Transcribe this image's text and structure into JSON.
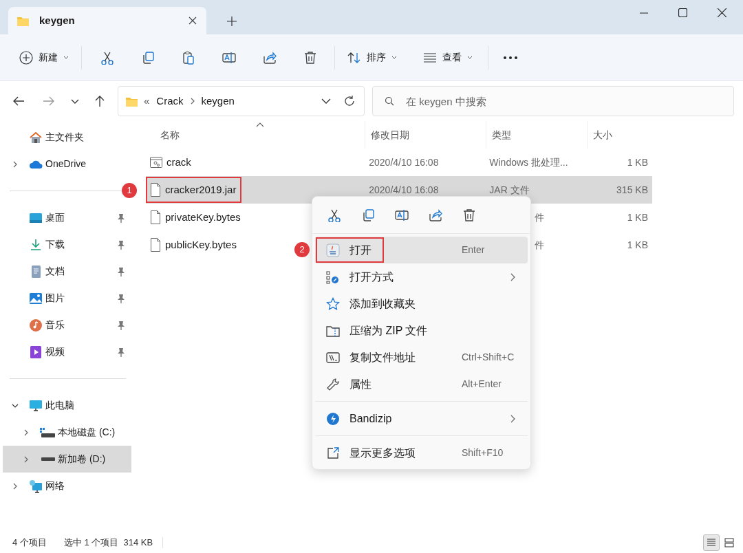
{
  "tab": {
    "title": "keygen",
    "selected": true
  },
  "toolbar": {
    "new_label": "新建",
    "sort_label": "排序",
    "view_label": "查看"
  },
  "address": {
    "overflow": "«",
    "path": [
      "Crack",
      "keygen"
    ]
  },
  "search": {
    "placeholder": "在 keygen 中搜索"
  },
  "sidebar": {
    "sections": [
      [
        {
          "label": "主文件夹",
          "pinned": false
        },
        {
          "label": "OneDrive",
          "pinned": false,
          "expanded": false
        }
      ],
      [
        {
          "label": "桌面",
          "pinned": true
        },
        {
          "label": "下载",
          "pinned": true
        },
        {
          "label": "文档",
          "pinned": true
        },
        {
          "label": "图片",
          "pinned": true
        },
        {
          "label": "音乐",
          "pinned": true
        },
        {
          "label": "视频",
          "pinned": true
        }
      ],
      [
        {
          "label": "此电脑",
          "pinned": false,
          "expanded": true,
          "children": [
            {
              "label": "本地磁盘 (C:)",
              "expanded": false,
              "selected": false
            },
            {
              "label": "新加卷 (D:)",
              "expanded": false,
              "selected": true
            }
          ]
        },
        {
          "label": "网络",
          "pinned": false,
          "expanded": false
        }
      ]
    ]
  },
  "table": {
    "columns": [
      "名称",
      "修改日期",
      "类型",
      "大小"
    ],
    "rows": [
      {
        "kind": "batch",
        "name": "crack",
        "date": "2020/4/10 16:08",
        "type": "Windows 批处理...",
        "size": "1 KB",
        "selected": false
      },
      {
        "kind": "file",
        "name": "cracker2019.jar",
        "date": "2020/4/10 16:08",
        "type": "JAR 文件",
        "size": "315 KB",
        "selected": true,
        "badge": "1"
      },
      {
        "kind": "file",
        "name": "privateKey.bytes",
        "type_tail": "件",
        "size": "1 KB",
        "selected": false
      },
      {
        "kind": "file",
        "name": "publicKey.bytes",
        "type_tail": "件",
        "size": "1 KB",
        "selected": false
      }
    ]
  },
  "context_menu": {
    "groups": [
      [
        {
          "kind": "java",
          "label": "打开",
          "shortcut": "Enter",
          "hovered": true,
          "badge": "2"
        },
        {
          "kind": "openwith",
          "label": "打开方式",
          "submenu": true,
          "hovered": false
        },
        {
          "kind": "star",
          "label": "添加到收藏夹",
          "hovered": false
        },
        {
          "kind": "zip",
          "label": "压缩为 ZIP 文件",
          "hovered": false
        },
        {
          "kind": "path",
          "label": "复制文件地址",
          "shortcut": "Ctrl+Shift+C",
          "hovered": false
        },
        {
          "kind": "wrench",
          "label": "属性",
          "shortcut": "Alt+Enter",
          "hovered": false
        }
      ],
      [
        {
          "kind": "bandizip",
          "label": "Bandizip",
          "submenu": true,
          "hovered": false
        }
      ],
      [
        {
          "kind": "more",
          "label": "显示更多选项",
          "shortcut": "Shift+F10",
          "hovered": false
        }
      ]
    ]
  },
  "status_bar": {
    "count": "4 个项目",
    "selection": "选中 1 个项目  314 KB",
    "views": [
      {
        "selected": true
      },
      {
        "selected": false
      }
    ]
  }
}
